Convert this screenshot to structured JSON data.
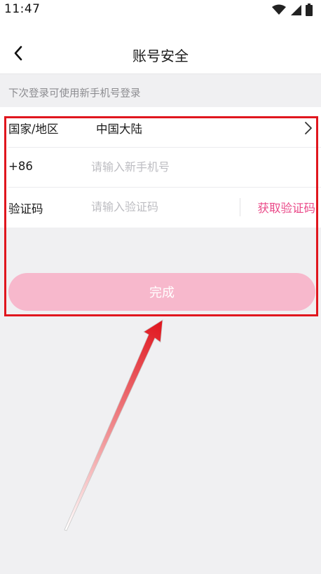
{
  "status_bar": {
    "time": "11:47",
    "icons": [
      "wifi-icon",
      "cellular-signal-icon",
      "battery-icon"
    ]
  },
  "nav": {
    "back_icon": "chevron-left-icon",
    "title": "账号安全"
  },
  "hint": "下次登录可使用新手机号登录",
  "form": {
    "country": {
      "label": "国家/地区",
      "value": "中国大陆",
      "icon": "chevron-right-icon"
    },
    "phone": {
      "label": "+86",
      "placeholder": "请输入新手机号",
      "value": ""
    },
    "code": {
      "label": "验证码",
      "placeholder": "请输入验证码",
      "value": "",
      "get_code_label": "获取验证码"
    }
  },
  "done_button": "完成",
  "colors": {
    "accent": "#ea4a89",
    "button_disabled": "#f7b8cc",
    "background": "#f0f0f2",
    "annotation": "#e0161e"
  }
}
